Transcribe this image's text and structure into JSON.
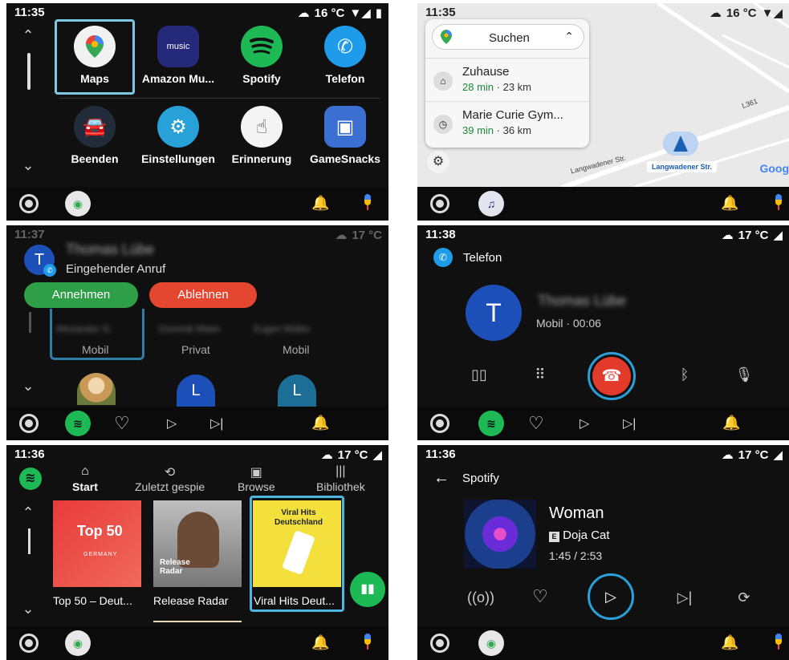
{
  "panel1": {
    "time": "11:35",
    "temp": "16 °C",
    "apps": [
      {
        "label": "Maps",
        "icon": "maps-icon"
      },
      {
        "label": "Amazon Mu...",
        "icon": "amazon-music-icon",
        "icon_text": "music"
      },
      {
        "label": "Spotify",
        "icon": "spotify-icon"
      },
      {
        "label": "Telefon",
        "icon": "phone-icon"
      },
      {
        "label": "Beenden",
        "icon": "car-icon"
      },
      {
        "label": "Einstellungen",
        "icon": "gear-icon"
      },
      {
        "label": "Erinnerung",
        "icon": "reminder-icon"
      },
      {
        "label": "GameSnacks",
        "icon": "gamesnacks-icon"
      }
    ]
  },
  "panel2": {
    "time": "11:35",
    "temp": "16 °C",
    "search_label": "Suchen",
    "destinations": [
      {
        "name": "Zuhause",
        "duration": "28 min",
        "distance": "· 23 km",
        "icon": "home-icon"
      },
      {
        "name": "Marie Curie Gym...",
        "duration": "39 min",
        "distance": "· 36 km",
        "icon": "history-icon"
      }
    ],
    "street_label": "Langwadener Str.",
    "current_street": "Langwadener Str.",
    "road_label": "L361",
    "map_brand": "Goog"
  },
  "panel3": {
    "time": "11:37",
    "temp": "17 °C",
    "avatar_letter": "T",
    "caller_blurred": "Thomas Lübe",
    "caller_status": "Eingehender Anruf",
    "accept_label": "Annehmen",
    "decline_label": "Ablehnen",
    "contacts": [
      {
        "label": "Mobil",
        "name": "Alexander G."
      },
      {
        "label": "Privat",
        "name": "Dominik Maier"
      },
      {
        "label": "Mobil",
        "name": "Eugen Müller"
      }
    ],
    "contact_avatars": [
      "L",
      "L"
    ]
  },
  "panel4": {
    "time": "11:38",
    "temp": "17 °C",
    "app_title": "Telefon",
    "avatar_letter": "T",
    "caller_blurred": "Thomas Lübe",
    "call_info": "Mobil · 00:06"
  },
  "panel5": {
    "time": "11:36",
    "temp": "17 °C",
    "tabs": [
      {
        "label": "Start",
        "icon": "⌂"
      },
      {
        "label": "Zuletzt gespie",
        "icon": "⟲"
      },
      {
        "label": "Browse",
        "icon": "▣"
      },
      {
        "label": "Bibliothek",
        "icon": "|||"
      }
    ],
    "tiles": [
      {
        "label": "Top 50 – Deut...",
        "cover_title": "Top 50",
        "cover_sub": "GERMANY"
      },
      {
        "label": "Release Radar",
        "cover_title": "Release Radar"
      },
      {
        "label": "Viral Hits Deut...",
        "cover_title": "Viral Hits Deutschland"
      }
    ]
  },
  "panel6": {
    "time": "11:36",
    "temp": "17 °C",
    "app_title": "Spotify",
    "track_title": "Woman",
    "artist": "Doja Cat",
    "explicit_badge": "E",
    "progress": "1:45 / 2:53"
  },
  "colors": {
    "accept": "#2e9e48",
    "decline": "#e5462f",
    "spotify": "#1db954",
    "accent_ring": "#2aa0d8",
    "call_blue": "#1d4fb8"
  }
}
